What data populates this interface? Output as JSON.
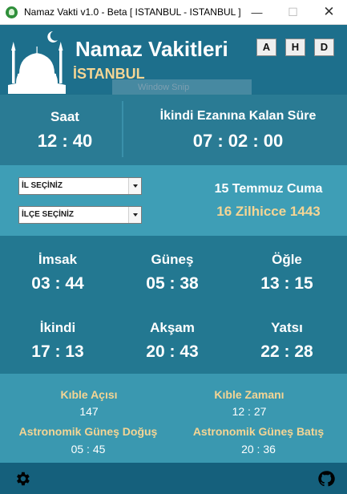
{
  "window": {
    "title": "Namaz Vakti v1.0 - Beta [ ISTANBUL - ISTANBUL ]",
    "min_glyph": "—",
    "max_glyph": "☐",
    "close_glyph": "✕"
  },
  "header": {
    "app_name": "Namaz Vakitleri",
    "city": "İSTANBUL",
    "font_buttons": [
      "A",
      "H",
      "D"
    ],
    "overlay_text": "Window Snip"
  },
  "clock": {
    "saat_label": "Saat",
    "saat_value": "12 : 40",
    "remaining_label": "İkindi Ezanına Kalan Süre",
    "remaining_value": "07 : 02 : 00"
  },
  "selectors": {
    "il": "İL SEÇİNİZ",
    "ilce": "İLÇE SEÇİNİZ"
  },
  "dates": {
    "gregorian": "15 Temmuz Cuma",
    "hijri": "16 Zilhicce 1443"
  },
  "prayers": [
    {
      "name": "İmsak",
      "time": "03 : 44"
    },
    {
      "name": "Güneş",
      "time": "05 : 38"
    },
    {
      "name": "Öğle",
      "time": "13 : 15"
    },
    {
      "name": "İkindi",
      "time": "17 : 13"
    },
    {
      "name": "Akşam",
      "time": "20 : 43"
    },
    {
      "name": "Yatsı",
      "time": "22 : 28"
    }
  ],
  "extra": {
    "kible_acisi_label": "Kıble Açısı",
    "kible_acisi_value": "147",
    "kible_zamani_label": "Kıble Zamanı",
    "kible_zamani_value": "12 : 27",
    "astro_dogus_label": "Astronomik Güneş Doğuş",
    "astro_dogus_value": "05 : 45",
    "astro_batis_label": "Astronomik Güneş Batış",
    "astro_batis_value": "20 : 36"
  },
  "icons": {
    "app": "namaz-vakti-app-icon",
    "logo": "mosque-crescent-icon",
    "settings": "gear-icon",
    "repo": "github-icon"
  },
  "colors": {
    "header_bg": "#1d6f8c",
    "accent_gold": "#f4d594",
    "panel_dark": "#237891",
    "panel_light": "#3e9eb6",
    "footer_bg": "#15607c"
  }
}
